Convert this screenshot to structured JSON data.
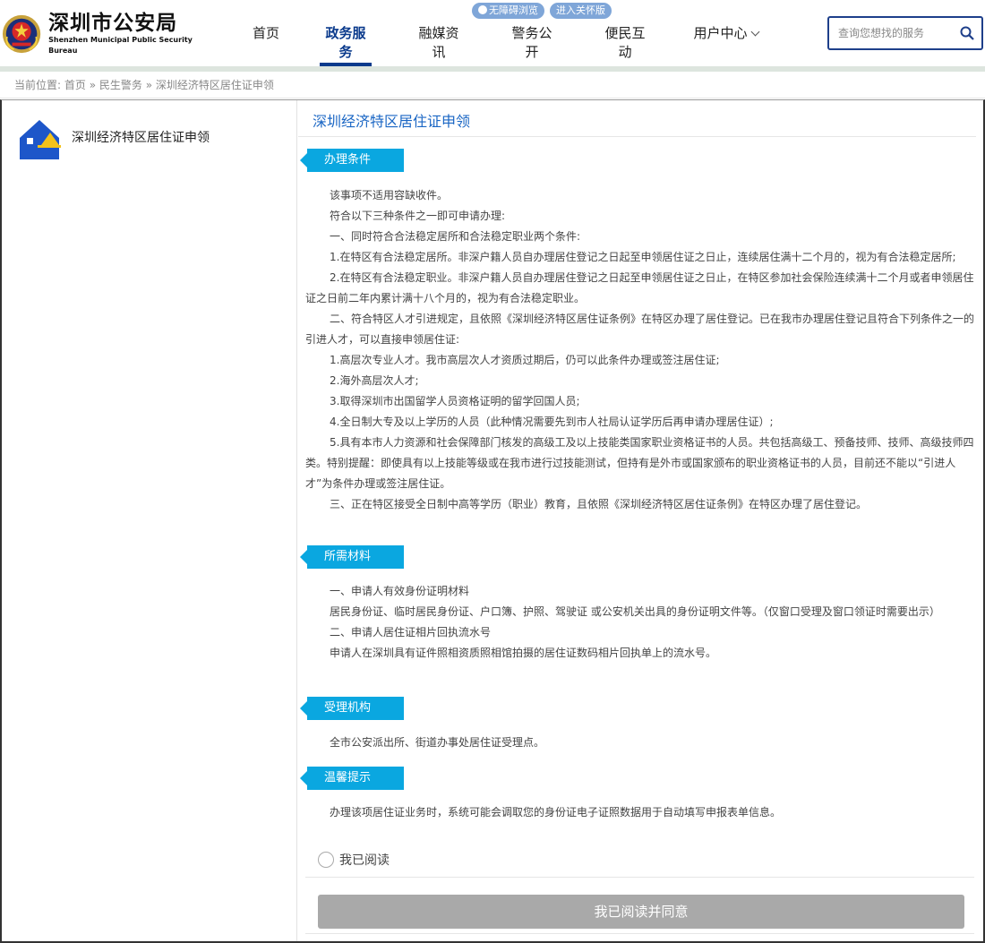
{
  "header": {
    "logo_cn": "深圳市公安局",
    "logo_en": "Shenzhen Municipal Public Security Bureau",
    "nav": [
      {
        "label": "首页",
        "active": false
      },
      {
        "label": "政务服务",
        "active": true
      },
      {
        "label": "融媒资讯",
        "active": false
      },
      {
        "label": "警务公开",
        "active": false
      },
      {
        "label": "便民互动",
        "active": false
      },
      {
        "label": "用户中心",
        "active": false
      }
    ],
    "badge_accessible": "无障碍浏览",
    "badge_care": "进入关怀版",
    "search_placeholder": "查询您想找的服务"
  },
  "breadcrumb": {
    "prefix": "当前位置:",
    "items": [
      "首页",
      "民生警务",
      "深圳经济特区居住证申领"
    ],
    "separator": "»"
  },
  "sidebar": {
    "item_label": "深圳经济特区居住证申领"
  },
  "content": {
    "title": "深圳经济特区居住证申领",
    "sections": [
      {
        "tag": "办理条件",
        "paragraphs": [
          "该事项不适用容缺收件。",
          "符合以下三种条件之一即可申请办理:",
          "一、同时符合合法稳定居所和合法稳定职业两个条件:",
          "1.在特区有合法稳定居所。非深户籍人员自办理居住登记之日起至申领居住证之日止，连续居住满十二个月的，视为有合法稳定居所;",
          "2.在特区有合法稳定职业。非深户籍人员自办理居住登记之日起至申领居住证之日止，在特区参加社会保险连续满十二个月或者申领居住证之日前二年内累计满十八个月的，视为有合法稳定职业。",
          "二、符合特区人才引进规定，且依照《深圳经济特区居住证条例》在特区办理了居住登记。已在我市办理居住登记且符合下列条件之一的引进人才，可以直接申领居住证:",
          "1.高层次专业人才。我市高层次人才资质过期后，仍可以此条件办理或签注居住证;",
          "2.海外高层次人才;",
          "3.取得深圳市出国留学人员资格证明的留学回国人员;",
          "4.全日制大专及以上学历的人员（此种情况需要先到市人社局认证学历后再申请办理居住证）;",
          "5.具有本市人力资源和社会保障部门核发的高级工及以上技能类国家职业资格证书的人员。共包括高级工、预备技师、技师、高级技师四类。特别提醒：即使具有以上技能等级或在我市进行过技能测试，但持有是外市或国家颁布的职业资格证书的人员，目前还不能以“引进人才”为条件办理或签注居住证。",
          "三、正在特区接受全日制中高等学历（职业）教育，且依照《深圳经济特区居住证条例》在特区办理了居住登记。"
        ]
      },
      {
        "tag": "所需材料",
        "paragraphs": [
          "一、申请人有效身份证明材料",
          "居民身份证、临时居民身份证、户口簿、护照、驾驶证 或公安机关出具的身份证明文件等。（仅窗口受理及窗口领证时需要出示）",
          "二、申请人居住证相片回执流水号",
          "申请人在深圳具有证件照相资质照相馆拍摄的居住证数码相片回执单上的流水号。"
        ]
      },
      {
        "tag": "受理机构",
        "paragraphs": [
          "全市公安派出所、街道办事处居住证受理点。"
        ]
      },
      {
        "tag": "温馨提示",
        "paragraphs": [
          "办理该项居住证业务时，系统可能会调取您的身份证电子证照数据用于自动填写申报表单信息。"
        ]
      }
    ],
    "read_label": "我已阅读",
    "agree_button": "我已阅读并同意"
  },
  "colors": {
    "brand": "#0a3a8c",
    "section_tag": "#0aa7e0",
    "title": "#1a66c4",
    "button_disabled": "#a9a9a9"
  }
}
